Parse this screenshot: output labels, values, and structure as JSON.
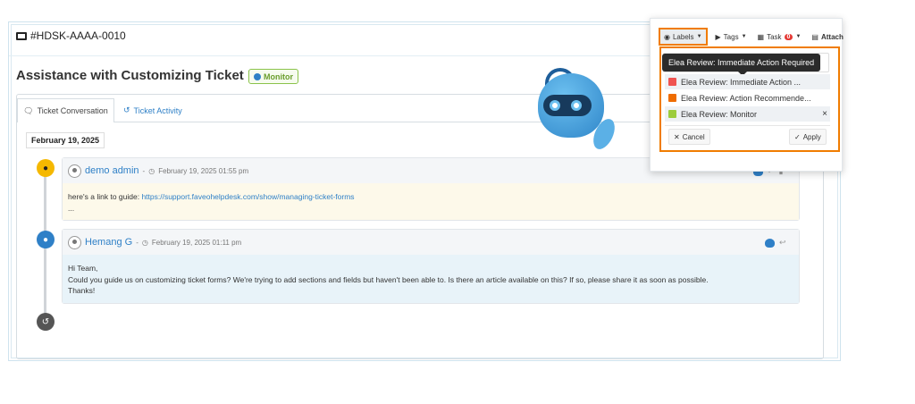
{
  "ticket": {
    "number": "#HDSK-AAAA-0010",
    "title": "Assistance with Customizing Ticket Forms",
    "badge_label": "Monitor"
  },
  "tabs": [
    {
      "label": "Ticket Conversation",
      "active": true
    },
    {
      "label": "Ticket Activity",
      "active": false
    }
  ],
  "timeline": {
    "date": "February 19, 2025",
    "messages": [
      {
        "author": "demo admin",
        "separator": "-",
        "timestamp": "February 19, 2025 01:55 pm",
        "body_prefix": "here's a link to guide: ",
        "body_link": "https://support.faveohelpdesk.com/show/managing-ticket-forms",
        "body_suffix": "..."
      },
      {
        "author": "Hemang G",
        "separator": "-",
        "timestamp": "February 19, 2025 01:11 pm",
        "body_lines": [
          "Hi Team,",
          "Could you guide us on customizing ticket forms? We're trying to add sections and fields but haven't been able to. Is there an article available on this? If so, please share it as soon as possible.",
          "Thanks!"
        ]
      }
    ]
  },
  "toolbar": {
    "labels": "Labels",
    "tags": "Tags",
    "task": "Task",
    "task_count": "0",
    "attach": "Attach"
  },
  "labels_dropdown": {
    "tooltip": "Elea Review: Immediate Action Required",
    "options": [
      {
        "label": "Elea Review: Immediate Action ...",
        "color": "#ef5350",
        "selected": false
      },
      {
        "label": "Elea Review: Action Recommende...",
        "color": "#ef6c00",
        "selected": false
      },
      {
        "label": "Elea Review: Monitor",
        "color": "#9ccc3c",
        "selected": true
      }
    ],
    "remove_symbol": "×",
    "cancel": "Cancel",
    "apply": "Apply"
  },
  "colors": {
    "accent": "#2f80c7",
    "highlight_border": "#f07c00",
    "warning_dot": "#f5b800"
  }
}
